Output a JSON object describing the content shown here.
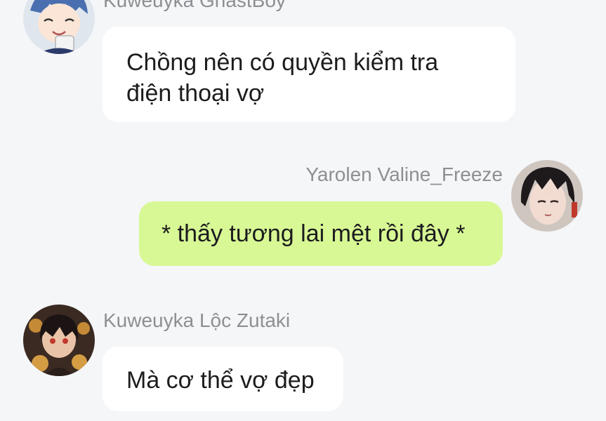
{
  "messages": [
    {
      "sender": "Kuweuyka GhastBoy",
      "text_lines": [
        "Chồng nên có quyền kiểm tra",
        "điện thoại vợ"
      ],
      "side": "left",
      "avatar_icon": "anime-boy-avatar-icon"
    },
    {
      "sender": "Yarolen Valine_Freeze",
      "text": "* thấy tương lai mệt rồi đây *",
      "side": "right",
      "avatar_icon": "anime-dark-hair-avatar-icon"
    },
    {
      "sender": "Kuweuyka Lộc Zutaki",
      "text": "Mà cơ thể vợ đẹp",
      "side": "left",
      "avatar_icon": "anime-lantern-avatar-icon"
    }
  ],
  "colors": {
    "background": "#f5f6f8",
    "incoming_bubble": "#ffffff",
    "outgoing_bubble": "#d8f895",
    "sender_name": "#8e8f93",
    "message_text": "#1c1c1e"
  }
}
